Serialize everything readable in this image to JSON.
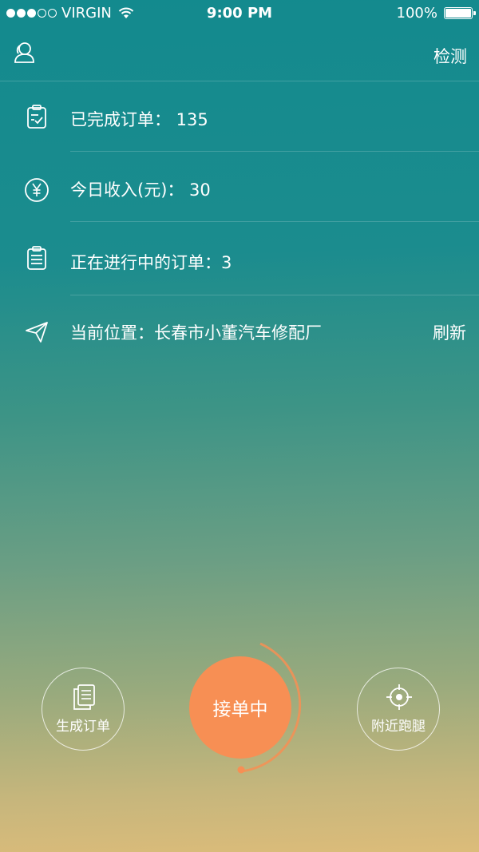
{
  "status_bar": {
    "carrier": "VIRGIN",
    "time": "9:00 PM",
    "battery": "100%",
    "battery_level": 1.0,
    "signal_bars_filled": 3,
    "signal_bars_total": 5
  },
  "nav": {
    "left_icon": "user-profile-icon",
    "right_action": "检测"
  },
  "info": {
    "completed_orders": "已完成订单： 135",
    "today_income": "今日收入(元)： 30",
    "in_progress_orders": "正在进行中的订单：3",
    "current_location": "当前位置：长春市小董汽车修配厂",
    "refresh": "刷新"
  },
  "icons": {
    "completed": "checklist-icon",
    "income": "yen-icon",
    "in_progress": "list-document-icon",
    "location": "send-arrow-icon"
  },
  "bottom": {
    "create_order": "生成订单",
    "accepting": "接单中",
    "nearby": "附近跑腿"
  },
  "colors": {
    "accent": "#f78f54",
    "gradient_top": "#138a8e",
    "gradient_bottom": "#dcbc7a"
  }
}
